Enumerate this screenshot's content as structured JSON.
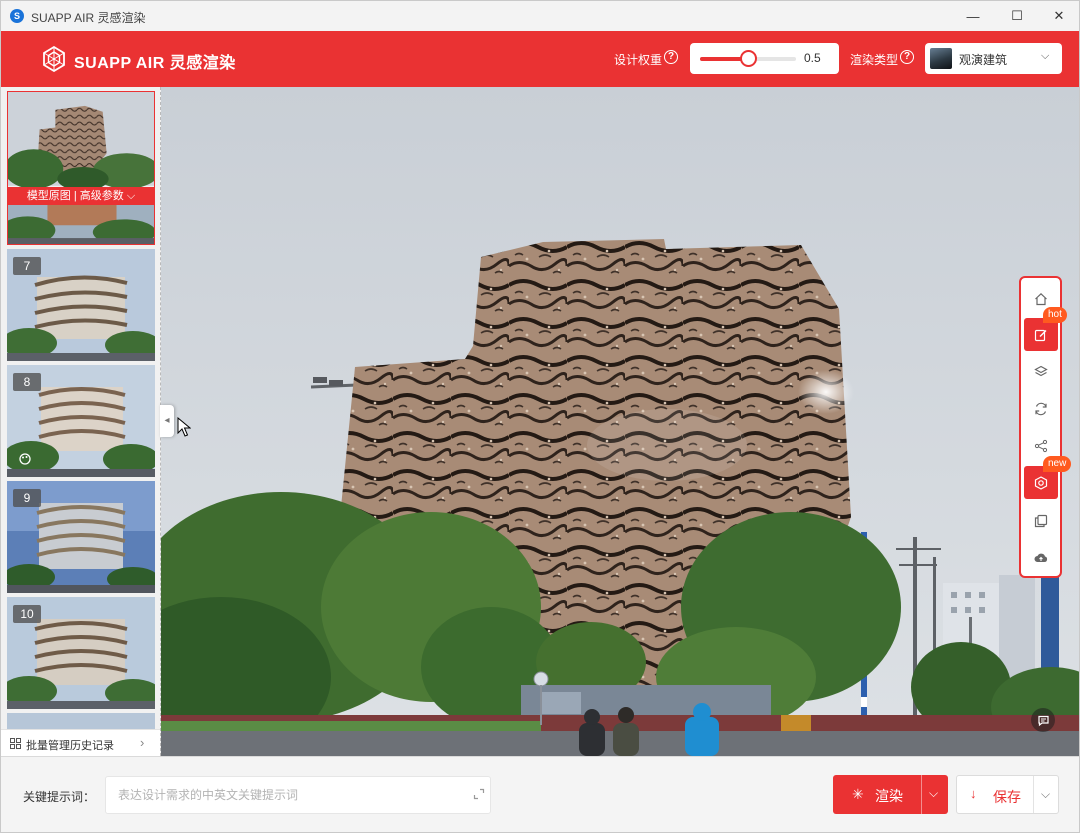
{
  "window": {
    "title": "SUAPP AIR 灵感渲染",
    "app_icon": "S",
    "minimize_glyph": "—",
    "maximize_glyph": "☐",
    "close_glyph": "✕"
  },
  "header": {
    "brand": "SUAPP AIR 灵感渲染",
    "design_weight_label": "设计权重",
    "help_glyph": "?",
    "design_weight_value": "0.5",
    "design_weight_fraction": 0.5,
    "render_type_label": "渲染类型",
    "render_type_value": "观演建筑",
    "chevron": "⌵"
  },
  "left_panel": {
    "original_caption": "模型原图 | 高级参数 ⌵",
    "thumbnails": [
      {
        "badge": "7"
      },
      {
        "badge": "8"
      },
      {
        "badge": "9"
      },
      {
        "badge": "10"
      }
    ],
    "history_label": "批量管理历史记录",
    "history_arrow": "›",
    "collapse_glyph": "◂"
  },
  "toolbar": {
    "tags": {
      "hot": "hot",
      "new": "new"
    }
  },
  "prompt": {
    "label": "关键提示词：",
    "placeholder": "表达设计需求的中英文关键提示词",
    "value": ""
  },
  "actions": {
    "render_label": "渲染",
    "render_icon": "✳",
    "save_label": "保存",
    "save_icon": "↓",
    "caret": "⌵"
  },
  "colors": {
    "brand_red": "#ea3233",
    "tag_orange": "#ff5a1f"
  }
}
